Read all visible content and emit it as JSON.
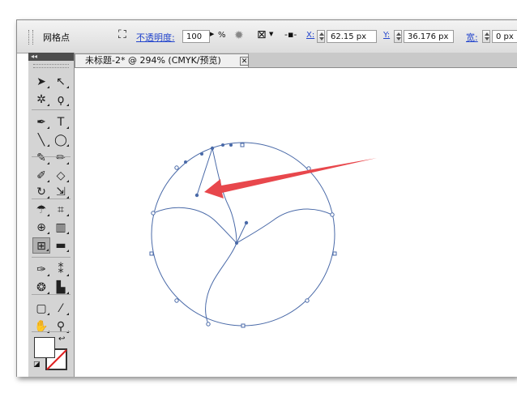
{
  "control_bar": {
    "tool_name": "网格点",
    "opacity_label": "不透明度:",
    "opacity_value": "100",
    "percent_sign": "%",
    "x_label": "X:",
    "x_value": "62.15 px",
    "y_label": "Y:",
    "y_value": "36.176 px",
    "width_label": "宽:",
    "width_value": "0 px"
  },
  "tools_panel": {
    "collapse_glyph": "◂◂"
  },
  "tools": [
    {
      "name": "selection-tool",
      "glyph": "➤"
    },
    {
      "name": "direct-selection-tool",
      "glyph": "↖"
    },
    {
      "name": "magic-wand-tool",
      "glyph": "✲"
    },
    {
      "name": "lasso-tool",
      "glyph": "ϙ"
    },
    {
      "name": "pen-tool",
      "glyph": "✒"
    },
    {
      "name": "type-tool",
      "glyph": "T"
    },
    {
      "name": "line-tool",
      "glyph": "╲"
    },
    {
      "name": "ellipse-tool",
      "glyph": "◯"
    },
    {
      "name": "paintbrush-tool",
      "glyph": "✎"
    },
    {
      "name": "pencil-tool",
      "glyph": "✏"
    },
    {
      "name": "blob-brush-tool",
      "glyph": "✐"
    },
    {
      "name": "eraser-tool",
      "glyph": "◇"
    },
    {
      "name": "rotate-tool",
      "glyph": "↻"
    },
    {
      "name": "scale-tool",
      "glyph": "⇲"
    },
    {
      "name": "warp-tool",
      "glyph": "☂"
    },
    {
      "name": "free-transform-tool",
      "glyph": "⌗"
    },
    {
      "name": "shape-builder-tool",
      "glyph": "⊕"
    },
    {
      "name": "perspective-grid-tool",
      "glyph": "▥"
    },
    {
      "name": "mesh-tool",
      "glyph": "⊞"
    },
    {
      "name": "gradient-tool",
      "glyph": "▬"
    },
    {
      "name": "eyedropper-tool",
      "glyph": "✑"
    },
    {
      "name": "blend-tool",
      "glyph": "⁑"
    },
    {
      "name": "symbol-sprayer-tool",
      "glyph": "❂"
    },
    {
      "name": "column-graph-tool",
      "glyph": "▙"
    },
    {
      "name": "artboard-tool",
      "glyph": "▢"
    },
    {
      "name": "slice-tool",
      "glyph": "⁄"
    },
    {
      "name": "hand-tool",
      "glyph": "✋"
    },
    {
      "name": "zoom-tool",
      "glyph": "⚲"
    }
  ],
  "document_tab": {
    "title": "未标题-2* @ 294% (CMYK/预览)",
    "close_glyph": "✕"
  },
  "colors": {
    "path_stroke": "#4a6aa8",
    "arrow": "#e8474c",
    "tab_bg": "#f0f0f0"
  }
}
